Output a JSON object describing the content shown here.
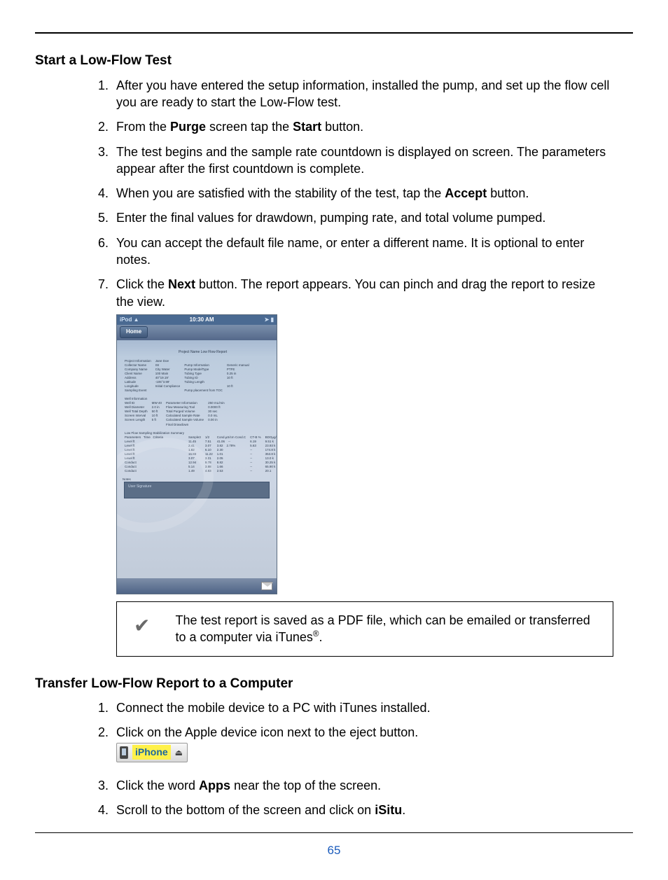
{
  "section1": {
    "title": "Start a Low-Flow Test",
    "steps": [
      {
        "pre": "After you have entered the setup information, installed the pump, and set up the flow cell you are ready to start the Low-Flow test."
      },
      {
        "pre": "From the ",
        "b1": "Purge",
        "mid": " screen tap the ",
        "b2": "Start",
        "post": " button."
      },
      {
        "pre": "The test begins and the sample rate countdown is displayed on screen. The parameters appear after the first countdown is complete."
      },
      {
        "pre": "When you are satisfied with the stability of the test, tap the ",
        "b1": "Accept",
        "post": " button."
      },
      {
        "pre": "Enter the final values for drawdown, pumping rate, and total volume pumped."
      },
      {
        "pre": "You can accept the default file name, or enter a different name. It is optional to enter notes."
      },
      {
        "pre": "Click the ",
        "b1": "Next",
        "post": " button. The report appears. You can pinch and drag the report to resize the view."
      }
    ]
  },
  "ipod": {
    "carrier": "iPod",
    "time": "10:30 AM",
    "home": "Home",
    "mail_icon": "mail-icon",
    "report_title": "Project Name   Low Flow Report"
  },
  "callout": {
    "text_a": "The test report is saved as a PDF file, which can be emailed or transferred to a computer via iTunes",
    "sup": "®",
    "text_b": "."
  },
  "section2": {
    "title": "Transfer Low-Flow Report to a Computer",
    "steps": [
      {
        "pre": "Connect the mobile device to a PC with iTunes installed."
      },
      {
        "pre": "Click on the Apple device icon next to the eject button."
      },
      {
        "pre": "Click the word ",
        "b1": "Apps",
        "post": " near the top of the screen."
      },
      {
        "pre": "Scroll to the bottom of the screen and click on ",
        "b1": "iSitu",
        "post": "."
      }
    ],
    "badge_label": "iPhone"
  },
  "page_number": "65"
}
